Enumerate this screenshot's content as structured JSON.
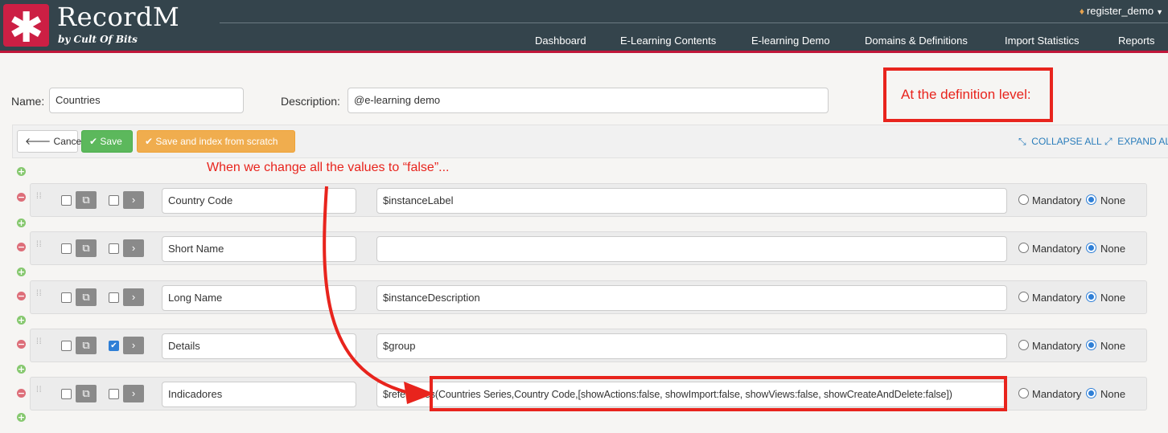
{
  "header": {
    "brand": "RecordM",
    "brand_sub": "by Cult Of Bits",
    "user": "register_demo",
    "nav": [
      "Dashboard",
      "E-Learning Contents",
      "E-learning Demo",
      "Domains & Definitions",
      "Import Statistics",
      "Reports"
    ]
  },
  "form": {
    "name_label": "Name:",
    "name_value": "Countries",
    "description_label": "Description:",
    "description_value": "@e-learning demo"
  },
  "toolbar": {
    "cancel": "Cancel",
    "save": "Save",
    "save_index": "Save and index from scratch",
    "collapse_all": "COLLAPSE ALL",
    "expand_all": "EXPAND ALL"
  },
  "annotations": {
    "definition_level": "At the definition level:",
    "change_values": "When we change all the values to “false”..."
  },
  "radio_labels": {
    "mandatory": "Mandatory",
    "none": "None"
  },
  "fields": [
    {
      "name": "Country Code",
      "description": "$instanceLabel",
      "checked": false,
      "none_selected": true
    },
    {
      "name": "Short Name",
      "description": "",
      "checked": false,
      "none_selected": true
    },
    {
      "name": "Long Name",
      "description": "$instanceDescription",
      "checked": false,
      "none_selected": true
    },
    {
      "name": "Details",
      "description": "$group",
      "checked": true,
      "none_selected": true
    },
    {
      "name": "Indicadores",
      "description": "$references(Countries Series,Country Code,[showActions:false, showImport:false, showViews:false, showCreateAndDelete:false])",
      "checked": false,
      "none_selected": true
    }
  ]
}
